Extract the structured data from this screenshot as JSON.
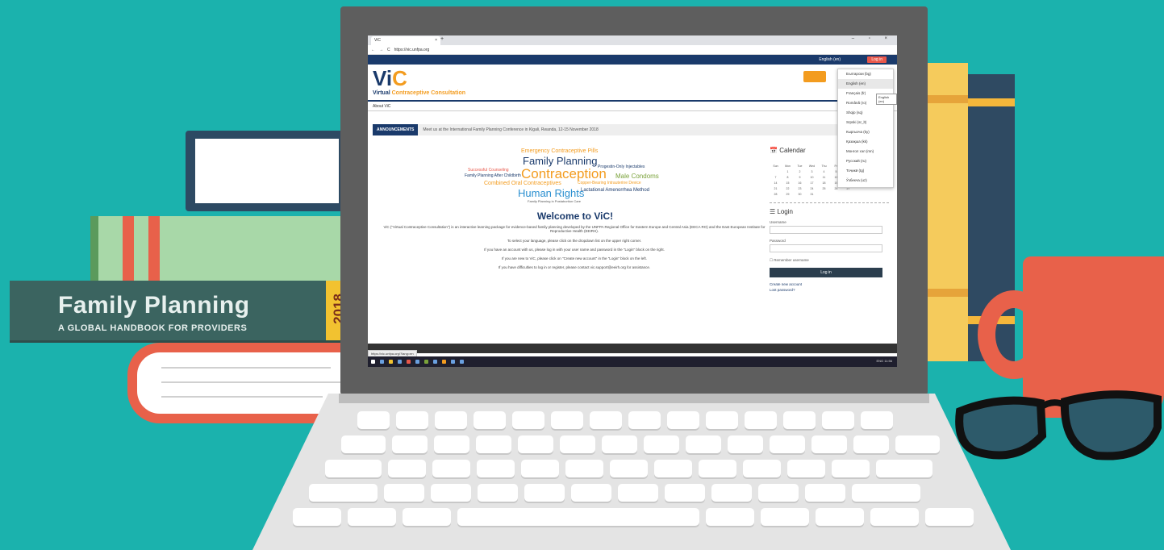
{
  "book": {
    "title": "Family Planning",
    "subtitle": "A GLOBAL HANDBOOK FOR PROVIDERS",
    "year": "2018"
  },
  "browser": {
    "tab_title": "ViC",
    "tab_close": "×",
    "new_tab": "+",
    "window_controls": "– ▫ ×",
    "url": "https://vic.unfpa.org",
    "nav_back": "←",
    "nav_forward": "→",
    "nav_reload": "C"
  },
  "site": {
    "language_selector": "English (en)",
    "login_button": "Log in",
    "logo_main": "Vi",
    "logo_accent": "C",
    "logo_sub_virtual": "Virtual",
    "logo_sub_rest": "Contraceptive Consultation",
    "about_link": "About ViC",
    "announce_label": "ANNOUNCEMENTS",
    "announce_text": "Meet us at the International Family Planning Conference in Kigali, Rwanda, 12-15 November 2018",
    "welcome_title": "Welcome to ViC!",
    "paragraphs": [
      "ViC (\"Virtual Contraceptive Consultation\") is an interactive learning package for evidence-based family planning developed by the UNFPA Regional Office for Eastern Europe and Central Asia (EECA RO) and the East European Institute for Reproductive Health (EEIRH).",
      "To select your language, please click on the dropdown list on the upper right corner.",
      "If you have an account with us, please log in with your user name and password in the \"Login\" block on the right.",
      "If you are new to ViC, please click on \"Create new account\" in the \"Login\" block on the left.",
      "If you have difficulties to log in or register, please contact vic.support@eeirh.org for assistance."
    ]
  },
  "wordcloud": [
    {
      "text": "Emergency Contraceptive Pills",
      "color": "#f39c1f"
    },
    {
      "text": "Family Planning",
      "color": "#1a3a6b"
    },
    {
      "text": "Progestin-Only Injectables",
      "color": "#1a3a6b"
    },
    {
      "text": "Successful Counseling",
      "color": "#e8574a"
    },
    {
      "text": "Contraception",
      "color": "#f39c1f"
    },
    {
      "text": "Family Planning After Childbirth",
      "color": "#1a3a6b"
    },
    {
      "text": "Male Condoms",
      "color": "#7aa23a"
    },
    {
      "text": "Combined Oral Contraceptives",
      "color": "#f39c1f"
    },
    {
      "text": "Copper-Bearing Intrauterine Device",
      "color": "#f39c1f"
    },
    {
      "text": "Human Rights",
      "color": "#2a8fd0"
    },
    {
      "text": "Lactational Amenorrhea Method",
      "color": "#1a3a6b"
    },
    {
      "text": "Family Planning in Postabortion Care",
      "color": "#555555"
    }
  ],
  "calendar": {
    "title": "Calendar",
    "month": "OCTOBER 2",
    "weekdays": [
      "Sun",
      "Mon",
      "Tue",
      "Wed",
      "Thu",
      "Fri",
      "Sat"
    ],
    "rows": [
      [
        "",
        "1",
        "2",
        "3",
        "4",
        "5",
        "6"
      ],
      [
        "7",
        "8",
        "9",
        "10",
        "11",
        "12",
        "13"
      ],
      [
        "14",
        "15",
        "16",
        "17",
        "18",
        "19",
        "20"
      ],
      [
        "21",
        "22",
        "23",
        "24",
        "25",
        "26",
        "27"
      ],
      [
        "28",
        "29",
        "30",
        "31",
        "",
        "",
        ""
      ]
    ]
  },
  "login_block": {
    "title": "Login",
    "username_label": "Username",
    "password_label": "Password",
    "remember": "Remember username",
    "submit": "Log in",
    "create_account": "Create new account",
    "lost_password": "Lost password?"
  },
  "language_menu": [
    "Български (bg)",
    "English (en)",
    "Français (fr)",
    "Română (ro)",
    "Shqip (sq)",
    "Srpski (sr_lt)",
    "Кыргызча (ky)",
    "Қазақша (kk)",
    "Монгол хэл (mn)",
    "Русский (ru)",
    "Тоҷикӣ (tg)",
    "Ўзбекча (uz)"
  ],
  "tooltip": "English (en)",
  "status_url": "https://vic.unfpa.org/?lang=en",
  "taskbar_clock": "ENG  11:56"
}
